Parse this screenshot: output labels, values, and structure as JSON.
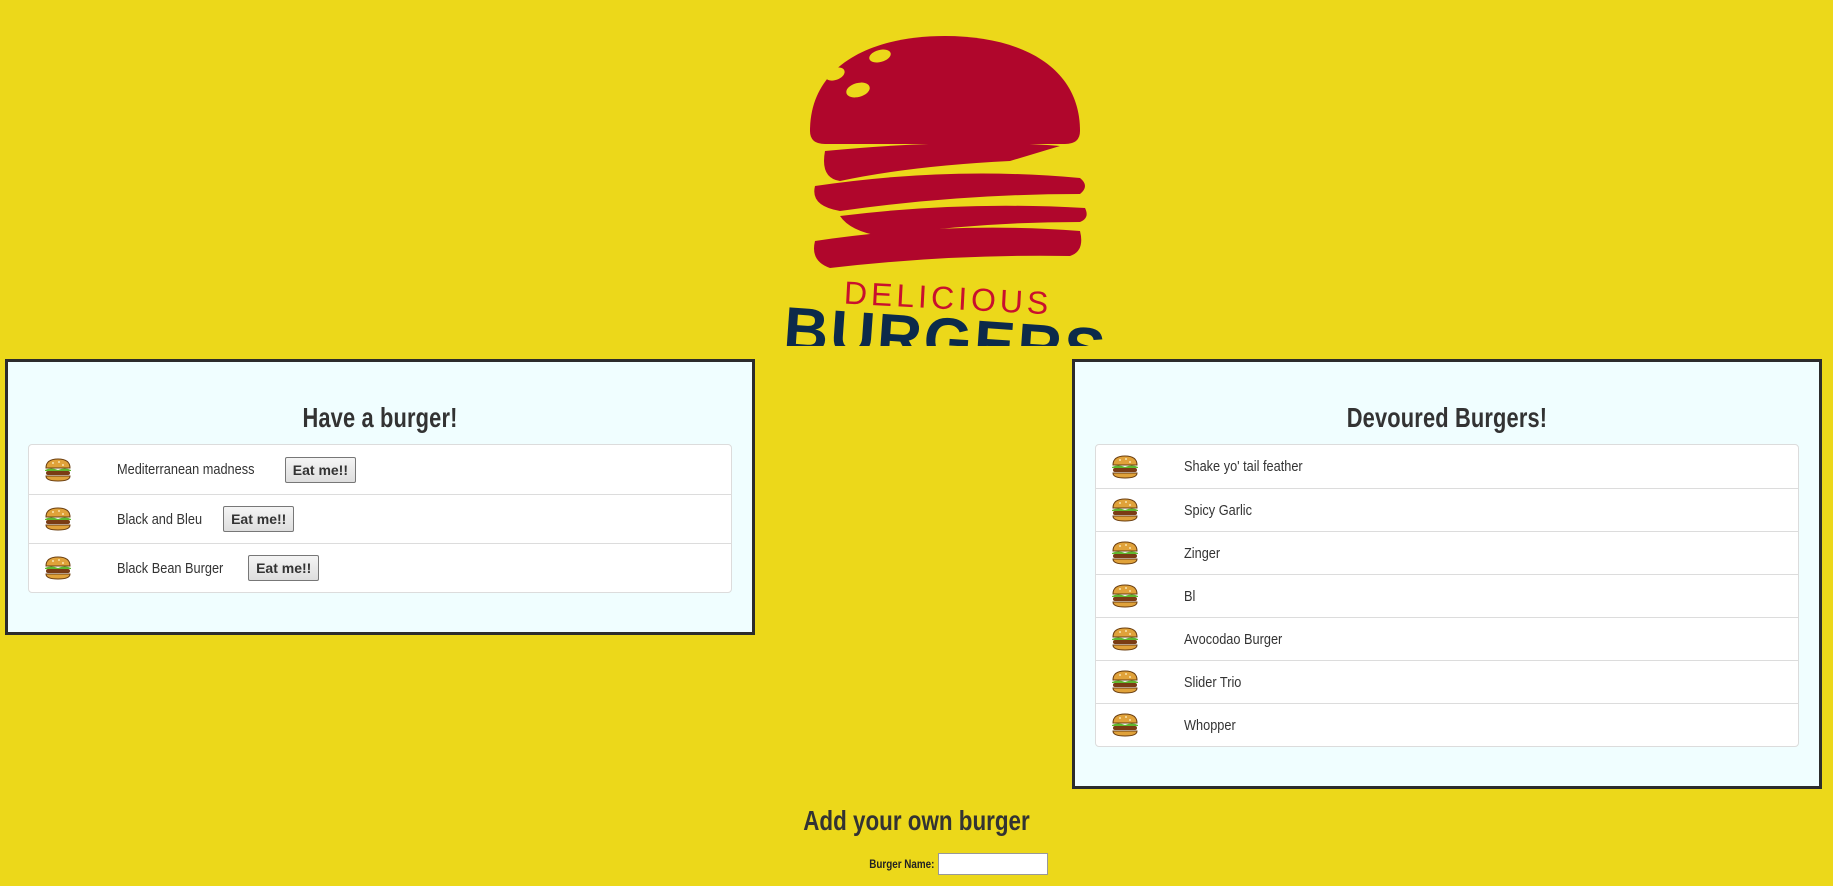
{
  "logo": {
    "line1": "DELICIOUS",
    "line2": "BURGERS"
  },
  "uneaten": {
    "title": "Have a burger!",
    "button_label": "Eat me!!",
    "items": [
      {
        "name": "Mediterranean madness"
      },
      {
        "name": "Black and Bleu"
      },
      {
        "name": "Black Bean Burger"
      }
    ]
  },
  "devoured": {
    "title": "Devoured Burgers!",
    "items": [
      {
        "name": "Shake yo' tail feather"
      },
      {
        "name": "Spicy Garlic"
      },
      {
        "name": "Zinger"
      },
      {
        "name": "Bl"
      },
      {
        "name": "Avocodao Burger"
      },
      {
        "name": "Slider Trio"
      },
      {
        "name": "Whopper"
      }
    ]
  },
  "add_form": {
    "title": "Add your own burger",
    "label": "Burger Name:",
    "input_value": ""
  },
  "colors": {
    "background": "#ecd81a",
    "panel": "#f0feff",
    "bun": "#b0062c",
    "logo_text_red": "#c8102e",
    "logo_text_navy": "#0c2a4a"
  },
  "icons": {
    "burger": "burger-icon"
  }
}
